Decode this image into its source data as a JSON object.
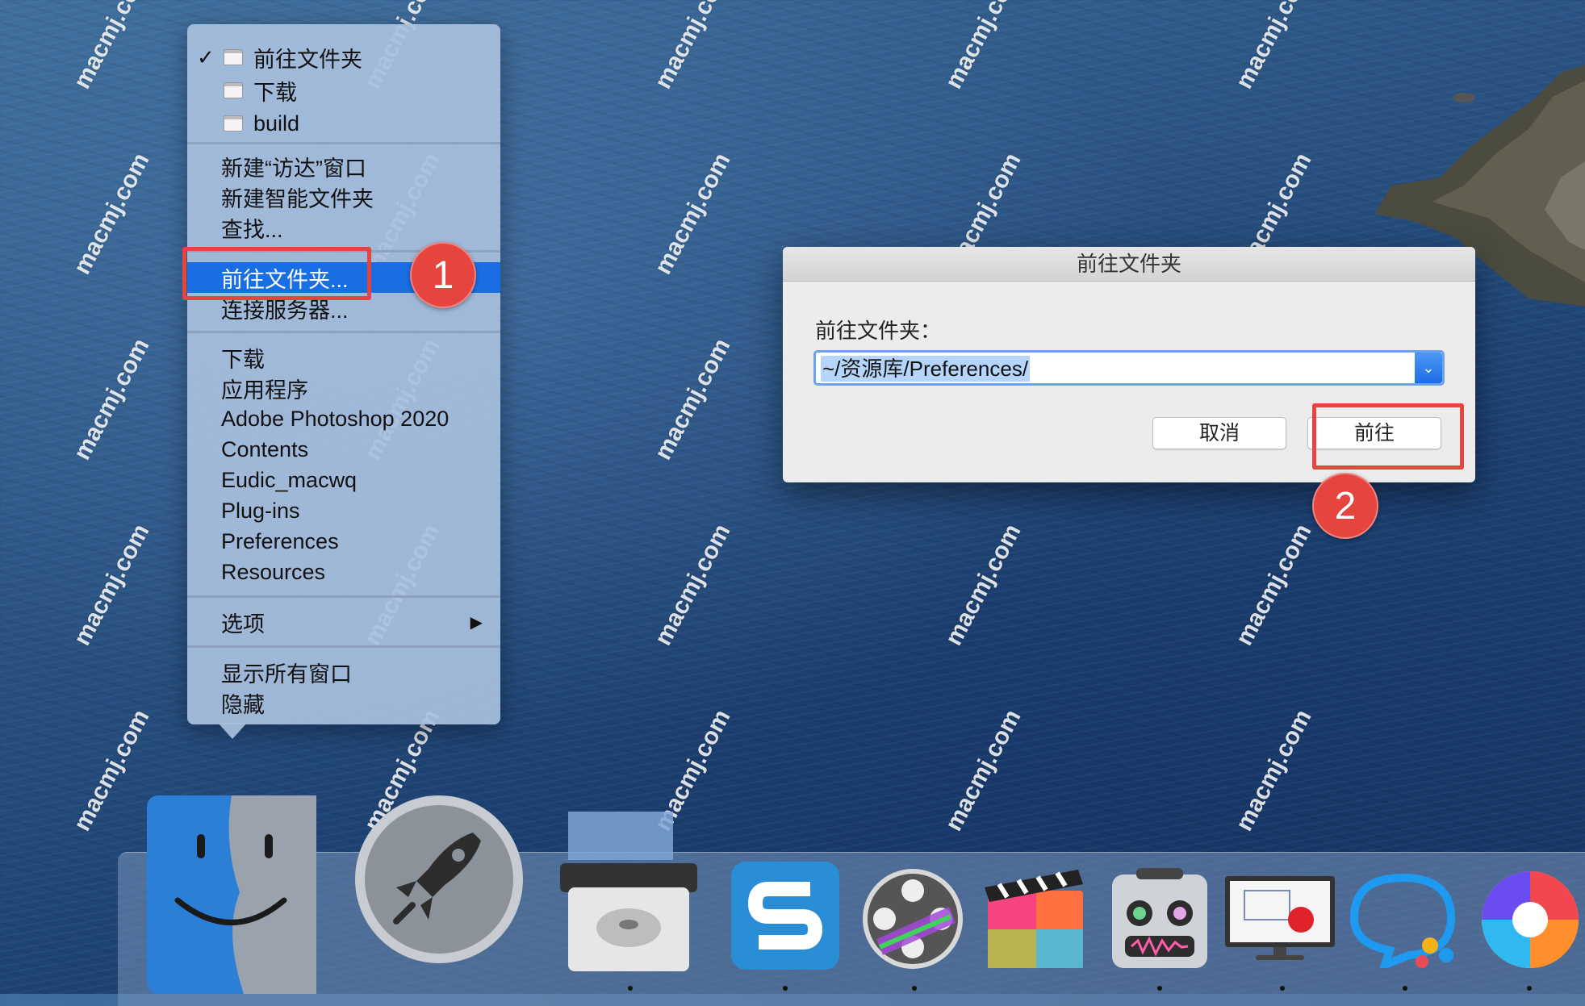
{
  "menu": {
    "recent": [
      {
        "label": "前往文件夹",
        "checked": true
      },
      {
        "label": "下载",
        "checked": false
      },
      {
        "label": "build",
        "checked": false
      }
    ],
    "actions": [
      "新建“访达”窗口",
      "新建智能文件夹",
      "查找..."
    ],
    "goto_items": [
      "前往文件夹...",
      "连接服务器..."
    ],
    "places": [
      "下载",
      "应用程序",
      "Adobe Photoshop 2020",
      "Contents",
      "Eudic_macwq",
      "Plug-ins",
      "Preferences",
      "Resources"
    ],
    "options": "选项",
    "window_items": [
      "显示所有窗口",
      "隐藏"
    ],
    "highlight_color": "#1a6ee3"
  },
  "dialog": {
    "title": "前往文件夹",
    "label": "前往文件夹：",
    "path_value": "~/资源库/Preferences/",
    "cancel_label": "取消",
    "go_label": "前往"
  },
  "annotations": {
    "step1": "1",
    "step2": "2",
    "color": "#e5443f"
  },
  "watermark": "macmj.com",
  "dock": {
    "icons": [
      "finder-icon",
      "launchpad-icon",
      "disk-utility-icon",
      "snagit-icon",
      "motion-icon",
      "final-cut-pro-icon",
      "voice-robot-icon",
      "screen-recorder-icon",
      "chat-app-icon",
      "colorful-app-icon"
    ]
  }
}
